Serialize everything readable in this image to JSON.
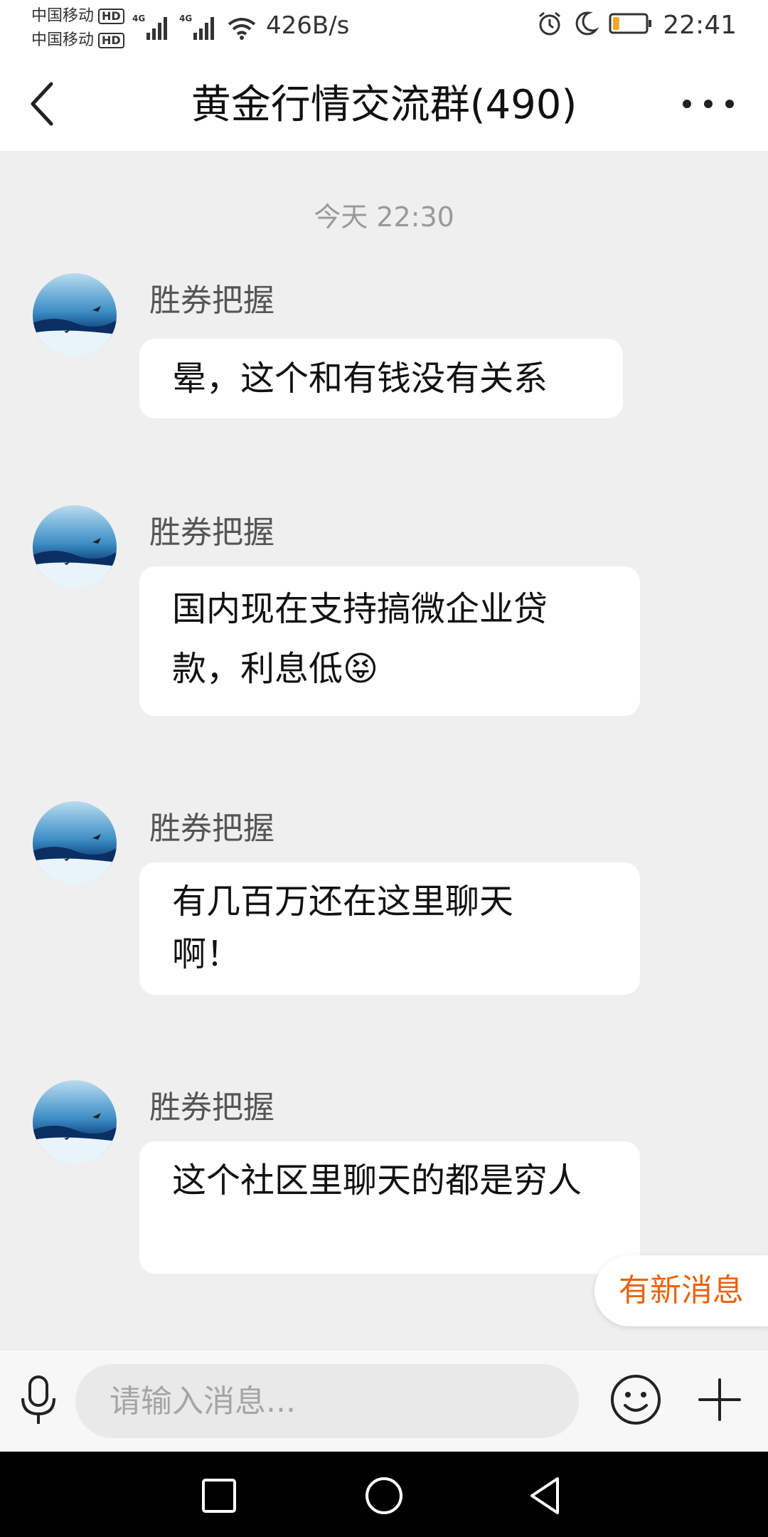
{
  "status_bar": {
    "carrier_1": "中国移动",
    "carrier_2": "中国移动",
    "hd": "HD",
    "network_type": "4G",
    "net_speed": "426B/s",
    "time": "22:41",
    "icons": [
      "signal-icon",
      "wifi-icon",
      "alarm-icon",
      "moon-icon",
      "battery-icon"
    ],
    "battery_level": 0.2,
    "battery_color": "#f5a623"
  },
  "header": {
    "title": "黄金行情交流群(490)",
    "back_icon": "chevron-left-icon",
    "more_icon": "more-dots-icon"
  },
  "chat": {
    "time_divider": "今天 22:30",
    "messages": [
      {
        "sender": "胜券把握",
        "text": "晕，这个和有钱没有关系"
      },
      {
        "sender": "胜券把握",
        "text": "国内现在支持搞微企业贷款，利息低😝"
      },
      {
        "sender": "胜券把握",
        "text": "有几百万还在这里聊天啊！"
      },
      {
        "sender": "胜券把握",
        "text": "这个社区里聊天的都是穷人"
      }
    ],
    "new_messages_label": "有新消息",
    "accent_color": "#e8640f"
  },
  "input_bar": {
    "placeholder": "请输入消息...",
    "value": "",
    "icons": [
      "microphone-icon",
      "emoji-icon",
      "plus-icon"
    ]
  },
  "nav_bar": {
    "icons": [
      "recent-apps-icon",
      "home-icon",
      "back-triangle-icon"
    ]
  }
}
